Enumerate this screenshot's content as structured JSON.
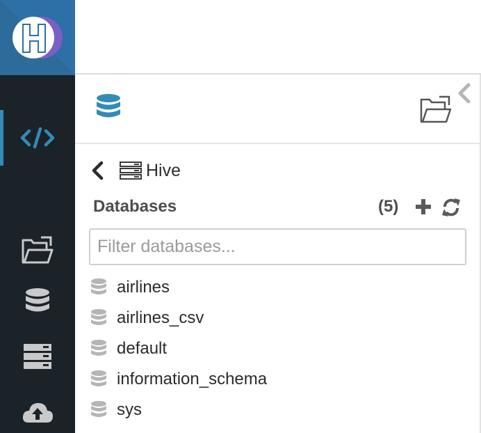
{
  "app": {
    "logo_letter": "H",
    "logo_badge": "c"
  },
  "rail": {
    "items": [
      {
        "name": "editor",
        "icon": "code-icon",
        "active": true
      },
      {
        "name": "files",
        "icon": "folder-open-icon"
      },
      {
        "name": "databases",
        "icon": "database-icon"
      },
      {
        "name": "tables",
        "icon": "server-icon"
      },
      {
        "name": "importer",
        "icon": "cloud-upload-icon"
      }
    ]
  },
  "panel": {
    "tabs": [
      {
        "name": "sql",
        "icon": "database-icon",
        "active": true
      },
      {
        "name": "files",
        "icon": "folder-open-icon"
      }
    ],
    "collapse_icon": "chevron-left-icon",
    "source": {
      "back_icon": "chevron-left-icon",
      "icon": "server-icon",
      "name": "Hive"
    },
    "section_title": "Databases",
    "count": "(5)",
    "filter": {
      "placeholder": "Filter databases...",
      "value": ""
    },
    "databases": [
      "airlines",
      "airlines_csv",
      "default",
      "information_schema",
      "sys"
    ]
  },
  "colors": {
    "rail_bg": "#1b2228",
    "logo_bg": "#2d6fa7",
    "accent": "#338bb8",
    "db_tab_icon": "#338bb8",
    "muted_icon": "#b5b5b5"
  }
}
